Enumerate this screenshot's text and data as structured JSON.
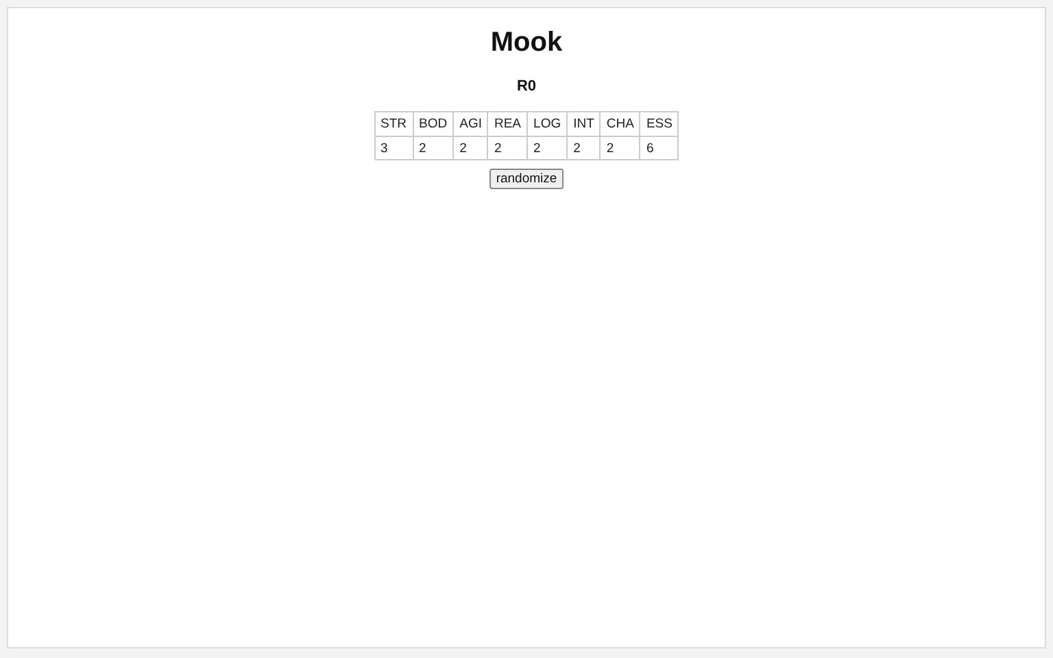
{
  "title": "Mook",
  "subtitle": "R0",
  "table": {
    "columns": [
      "STR",
      "BOD",
      "AGI",
      "REA",
      "LOG",
      "INT",
      "CHA",
      "ESS"
    ],
    "rows": [
      [
        "3",
        "2",
        "2",
        "2",
        "2",
        "2",
        "2",
        "6"
      ]
    ]
  },
  "button": "randomize"
}
